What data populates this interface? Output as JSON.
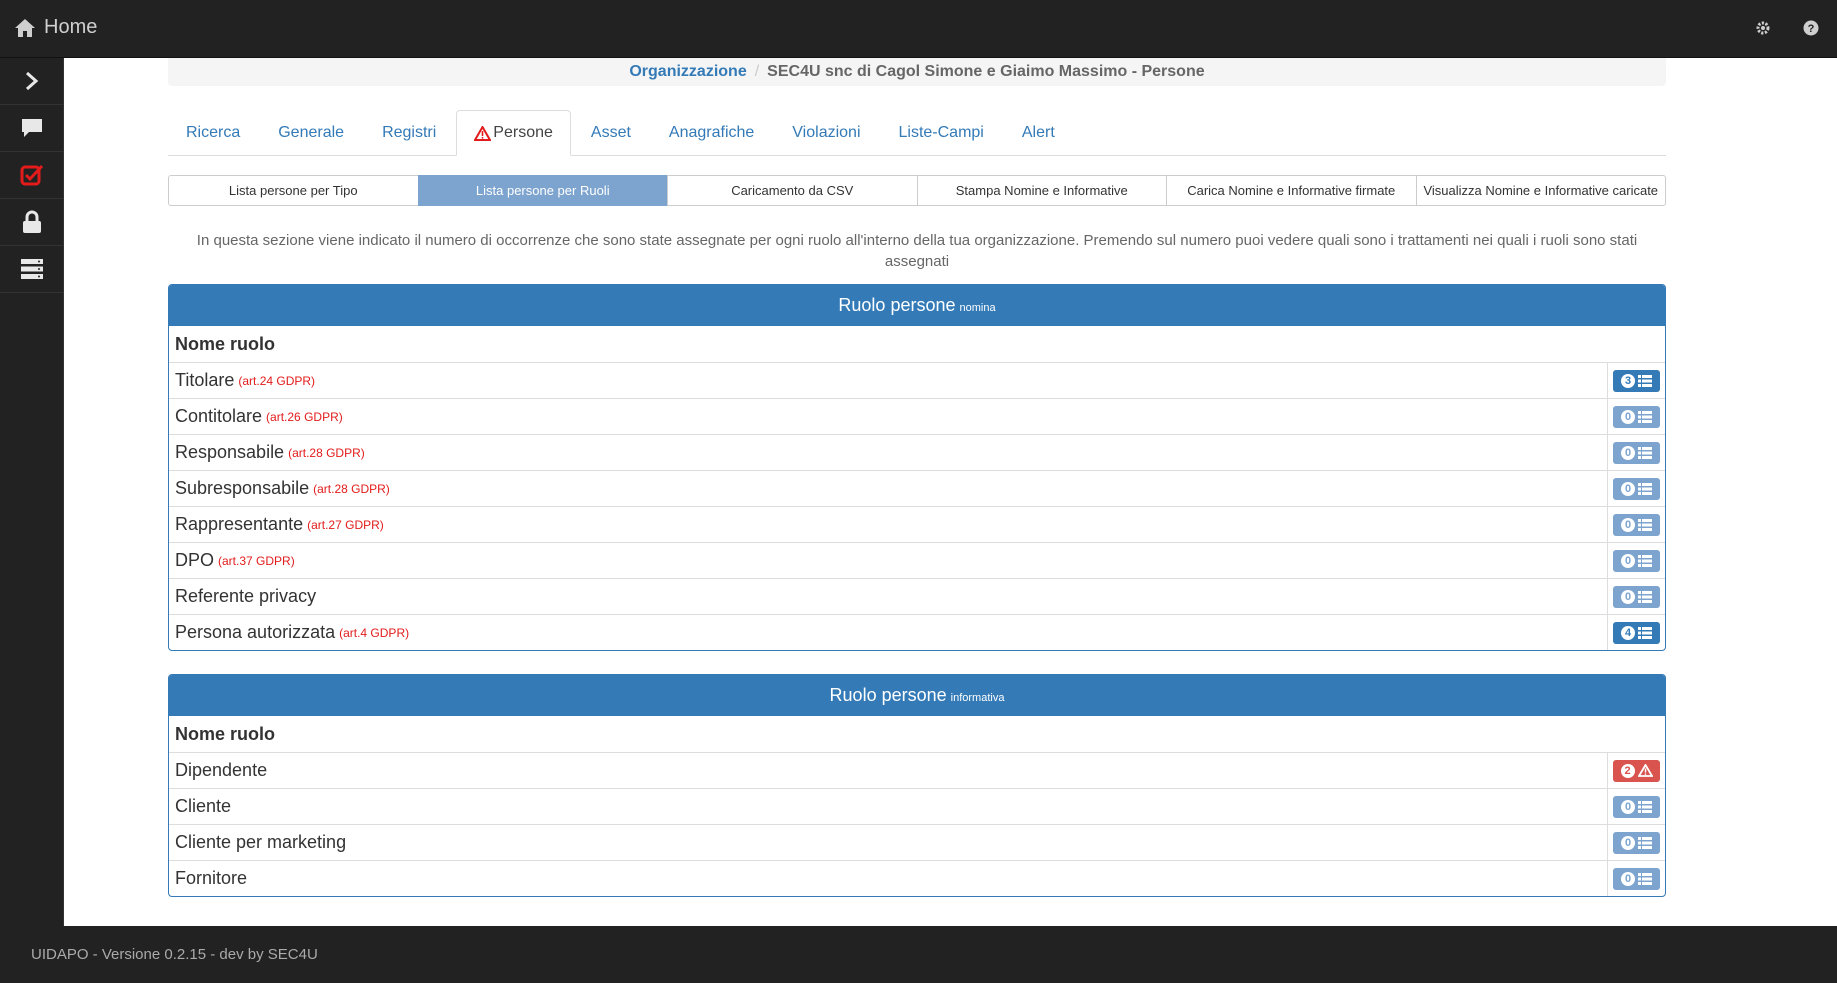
{
  "topbar": {
    "title": "Home",
    "icons": [
      "home-icon",
      "gear-icon",
      "help-icon"
    ]
  },
  "sidebar": {
    "items": [
      "chevron-right-icon",
      "chat-icon",
      "checkbox-icon",
      "lock-icon",
      "server-icon"
    ]
  },
  "breadcrumb": {
    "root": "Organizzazione",
    "separator": "/",
    "current": "SEC4U snc di Cagol Simone e Giaimo Massimo - Persone"
  },
  "tabs": [
    "Ricerca",
    "Generale",
    "Registri",
    "Persone",
    "Asset",
    "Anagrafiche",
    "Violazioni",
    "Liste-Campi",
    "Alert"
  ],
  "subnav": [
    "Lista persone per Tipo",
    "Lista persone per Ruoli",
    "Caricamento da CSV",
    "Stampa Nomine e Informative",
    "Carica Nomine e Informative firmate",
    "Visualizza Nomine e Informative caricate"
  ],
  "intro": "In questa sezione viene indicato il numero di occorrenze che sono state assegnate per ogni ruolo all'interno della tua organizzazione. Premendo sul numero puoi vedere quali sono i trattamenti nei quali i ruoli sono stati assegnati",
  "panel_nomina": {
    "title": "Ruolo persone",
    "subtitle": "nomina",
    "header": "Nome ruolo",
    "rows": [
      {
        "name": "Titolare",
        "art": "(art.24 GDPR)",
        "count": "3"
      },
      {
        "name": "Contitolare",
        "art": "(art.26 GDPR)",
        "count": "0"
      },
      {
        "name": "Responsabile",
        "art": "(art.28 GDPR)",
        "count": "0"
      },
      {
        "name": "Subresponsabile",
        "art": "(art.28 GDPR)",
        "count": "0"
      },
      {
        "name": "Rappresentante",
        "art": "(art.27 GDPR)",
        "count": "0"
      },
      {
        "name": "DPO",
        "art": "(art.37 GDPR)",
        "count": "0"
      },
      {
        "name": "Referente privacy",
        "art": "",
        "count": "0"
      },
      {
        "name": "Persona autorizzata",
        "art": "(art.4 GDPR)",
        "count": "4"
      }
    ]
  },
  "panel_informativa": {
    "title": "Ruolo persone",
    "subtitle": "informativa",
    "header": "Nome ruolo",
    "rows": [
      {
        "name": "Dipendente",
        "count": "2"
      },
      {
        "name": "Cliente",
        "count": "0"
      },
      {
        "name": "Cliente per marketing",
        "count": "0"
      },
      {
        "name": "Fornitore",
        "count": "0"
      }
    ]
  },
  "footer": {
    "text": "UIDAPO - Versione 0.2.15 - dev by SEC4U"
  },
  "colors": {
    "primary": "#337ab7",
    "light_primary": "#7ca4cf",
    "danger": "#d9534f",
    "dark": "#222222",
    "art_red": "#e31b1b"
  }
}
